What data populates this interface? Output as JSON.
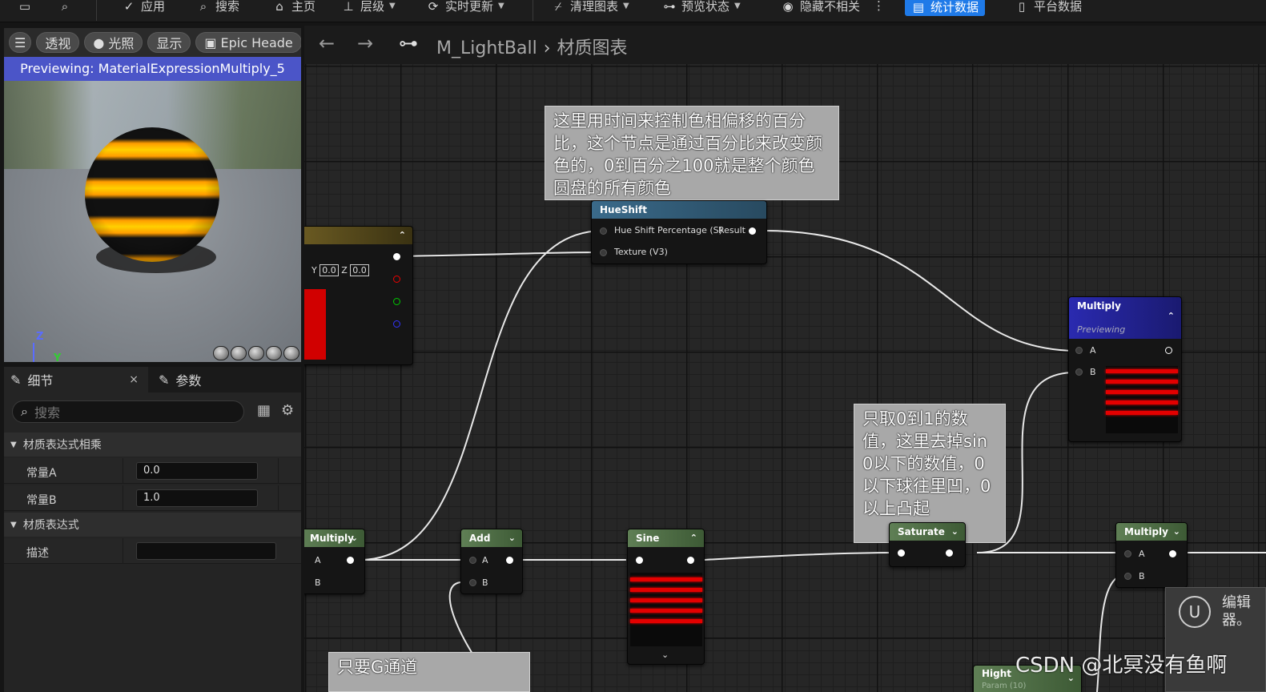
{
  "toolbar": {
    "apply": "应用",
    "search": "搜索",
    "home": "主页",
    "hierarchy": "层级",
    "live_update": "实时更新",
    "clean_graph": "清理图表",
    "preview_state": "预览状态",
    "hide_unrelated": "隐藏不相关",
    "stats": "统计数据",
    "platform_stats": "平台数据"
  },
  "viewport": {
    "perspective": "透视",
    "lit": "光照",
    "show": "显示",
    "epic": "Epic Heade",
    "preview_label": "Previewing: MaterialExpressionMultiply_5",
    "axis_z": "Z",
    "axis_y": "Y"
  },
  "details": {
    "tab_details": "细节",
    "tab_params": "参数",
    "close": "×",
    "search_placeholder": "搜索",
    "cat1": "材质表达式相乘",
    "const_a_label": "常量A",
    "const_a_value": "0.0",
    "const_b_label": "常量B",
    "const_b_value": "1.0",
    "cat2": "材质表达式",
    "desc_label": "描述",
    "desc_value": ""
  },
  "graph": {
    "breadcrumb_material": "M_LightBall",
    "breadcrumb_graph": "材质图表",
    "comment_hue": "这里用时间来控制色相偏移的百分比，这个节点是通过百分比来改变颜色的，0到百分之100就是整个颜色圆盘的所有颜色",
    "comment_saturate": "只取0到1的数值，这里去掉sin 0以下的数值，0以下球往里凹，0以上凸起",
    "comment_g": "只要G通道",
    "hueshift": {
      "title": "HueShift",
      "pin_hue": "Hue Shift Percentage (S)",
      "pin_result": "Result",
      "pin_texture": "Texture (V3)"
    },
    "const_node": {
      "y_label": "Y",
      "y_value": "0.0",
      "z_label": "Z",
      "z_value": "0.0"
    },
    "multiply_main": {
      "title": "Multiply",
      "sub": "Previewing",
      "pin_a": "A",
      "pin_b": "B"
    },
    "multiply_left": {
      "title": "Multiply",
      "pin_a": "A",
      "pin_b": "B"
    },
    "add": {
      "title": "Add",
      "pin_a": "A",
      "pin_b": "B"
    },
    "sine": {
      "title": "Sine"
    },
    "saturate": {
      "title": "Saturate"
    },
    "multiply_right": {
      "title": "Multiply",
      "pin_a": "A",
      "pin_b": "B"
    },
    "hight": {
      "title": "Hight",
      "sub": "Param (10)"
    },
    "ue_panel_text": "编辑器。"
  },
  "watermark": "CSDN @北冥没有鱼啊"
}
